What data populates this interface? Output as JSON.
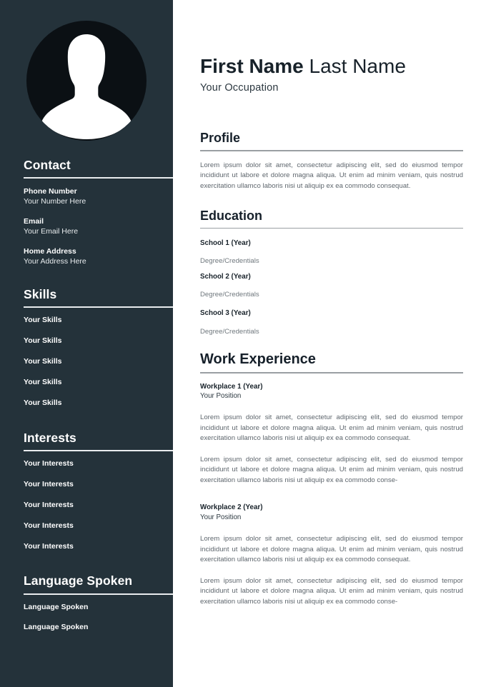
{
  "document": {
    "type": "resume-template",
    "colors": {
      "sidebar_bg": "#24323a",
      "avatar_bg": "#0b1014",
      "sidebar_text": "#ffffff",
      "sidebar_rule": "#e9ecee",
      "main_bg": "#ffffff",
      "heading": "#16202a",
      "body_text": "#5e666d",
      "main_rule": "#9a9fa3"
    }
  },
  "header": {
    "first_name": "First Name",
    "last_name": "Last Name",
    "occupation": "Your Occupation"
  },
  "sidebar": {
    "avatar": {
      "icon": "person-silhouette-icon"
    },
    "contact": {
      "heading": "Contact",
      "entries": [
        {
          "label": "Phone Number",
          "value": "Your Number Here"
        },
        {
          "label": "Email",
          "value": "Your Email Here"
        },
        {
          "label": "Home Address",
          "value": "Your Address Here"
        }
      ]
    },
    "skills": {
      "heading": "Skills",
      "items": [
        "Your Skills",
        "Your Skills",
        "Your Skills",
        "Your Skills",
        "Your Skills"
      ]
    },
    "interests": {
      "heading": "Interests",
      "items": [
        "Your Interests",
        "Your Interests",
        "Your Interests",
        "Your Interests",
        "Your Interests"
      ]
    },
    "languages": {
      "heading": "Language Spoken",
      "items": [
        "Language Spoken",
        "Language Spoken"
      ]
    }
  },
  "main": {
    "profile": {
      "heading": "Profile",
      "text": "Lorem ipsum dolor sit amet, consectetur adipiscing elit, sed do eiusmod tempor incididunt ut labore et dolore magna aliqua. Ut enim ad minim veniam, quis nostrud exercitation ullamco laboris nisi ut aliquip ex ea commodo consequat."
    },
    "education": {
      "heading": "Education",
      "entries": [
        {
          "title": "School 1 (Year)",
          "subtitle": "Degree/Credentials"
        },
        {
          "title": "School 2 (Year)",
          "subtitle": "Degree/Credentials"
        },
        {
          "title": "School 3 (Year)",
          "subtitle": "Degree/Credentials"
        }
      ]
    },
    "work": {
      "heading": "Work Experience",
      "entries": [
        {
          "title": "Workplace 1 (Year)",
          "position": "Your Position",
          "paragraphs": [
            "Lorem ipsum dolor sit amet, consectetur adipiscing elit, sed do eiusmod tempor incididunt ut labore et dolore magna aliqua. Ut enim ad minim veniam, quis nostrud exercitation ullamco laboris nisi ut aliquip ex ea commodo consequat.",
            "Lorem ipsum dolor sit amet, consectetur adipiscing elit, sed do eiusmod tempor incididunt ut labore et dolore magna aliqua. Ut enim ad minim veniam, quis nostrud exercitation ullamco laboris nisi ut aliquip ex ea commodo conse-"
          ]
        },
        {
          "title": "Workplace 2 (Year)",
          "position": "Your Position",
          "paragraphs": [
            "Lorem ipsum dolor sit amet, consectetur adipiscing elit, sed do eiusmod tempor incididunt ut labore et dolore magna aliqua. Ut enim ad minim veniam, quis nostrud exercitation ullamco laboris nisi ut aliquip ex ea commodo consequat.",
            "Lorem ipsum dolor sit amet, consectetur adipiscing elit, sed do eiusmod tempor incididunt ut labore et dolore magna aliqua. Ut enim ad minim veniam, quis nostrud exercitation ullamco laboris nisi ut aliquip ex ea commodo conse-"
          ]
        }
      ]
    }
  }
}
